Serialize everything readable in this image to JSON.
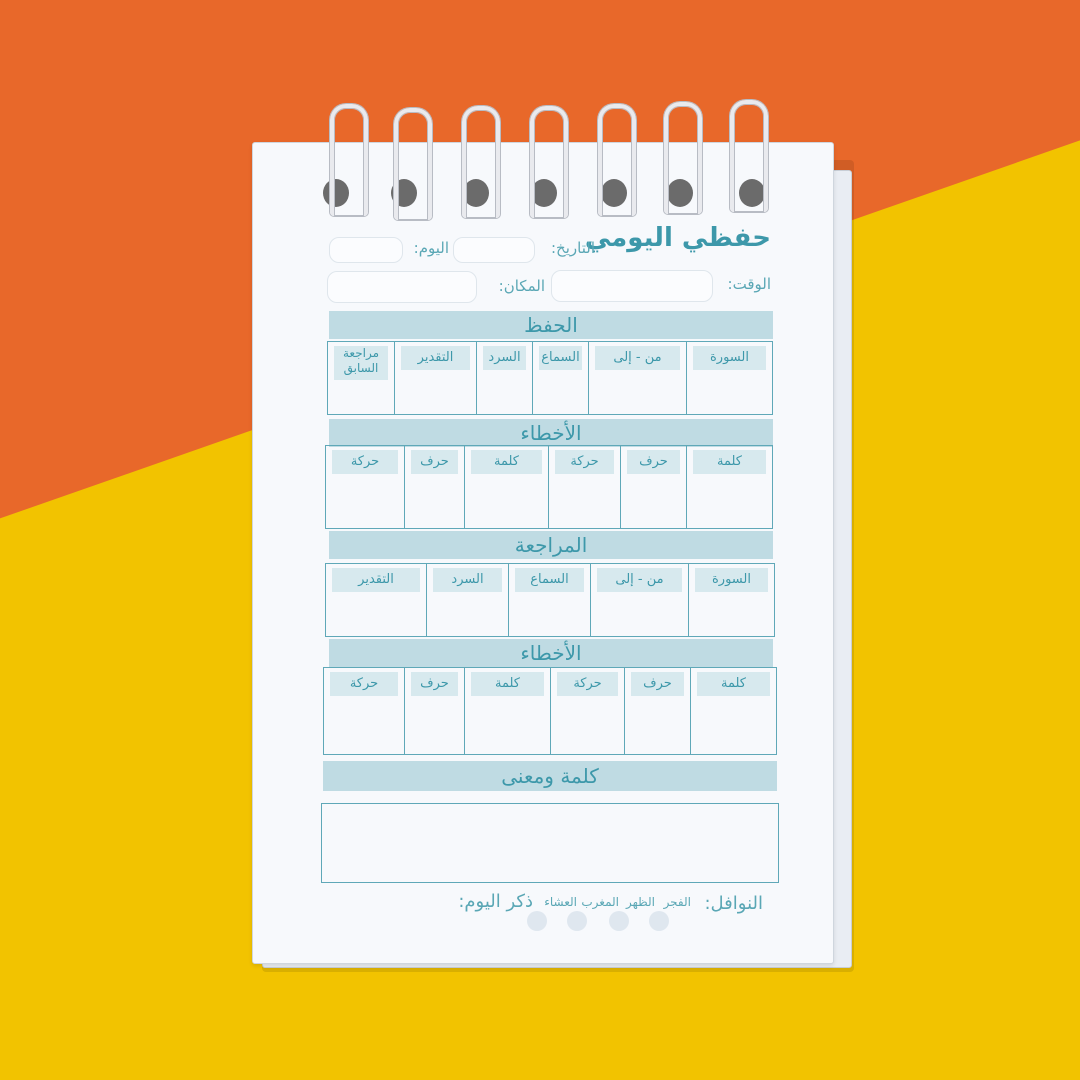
{
  "notebook": {
    "title": "حفظي اليومي",
    "header_fields": {
      "date": "التاريخ:",
      "day": "اليوم:",
      "time": "الوقت:",
      "place": "المكان:"
    },
    "sections": {
      "memorization": {
        "title": "الحفظ",
        "columns": [
          "السورة",
          "من - إلى",
          "السماع",
          "السرد",
          "التقدير",
          "مراجعة السابق"
        ]
      },
      "mistakes_1": {
        "title": "الأخطاء",
        "columns": [
          "كلمة",
          "حرف",
          "حركة",
          "كلمة",
          "حرف",
          "حركة"
        ]
      },
      "review": {
        "title": "المراجعة",
        "columns": [
          "السورة",
          "من - إلى",
          "السماع",
          "السرد",
          "التقدير"
        ]
      },
      "mistakes_2": {
        "title": "الأخطاء",
        "columns": [
          "كلمة",
          "حرف",
          "حركة",
          "كلمة",
          "حرف",
          "حركة"
        ]
      },
      "word_meaning": {
        "title": "كلمة ومعنى"
      }
    },
    "footer": {
      "nawafil_label": "النوافل:",
      "prayers": [
        "الفجر",
        "الظهر",
        "المغرب",
        "العشاء"
      ],
      "dhikr_label": "ذكر اليوم:"
    }
  },
  "colors": {
    "ink": "#3d98aa",
    "band": "#bfdbe3",
    "background_orange": "#e8682a",
    "background_yellow": "#f2c300"
  }
}
